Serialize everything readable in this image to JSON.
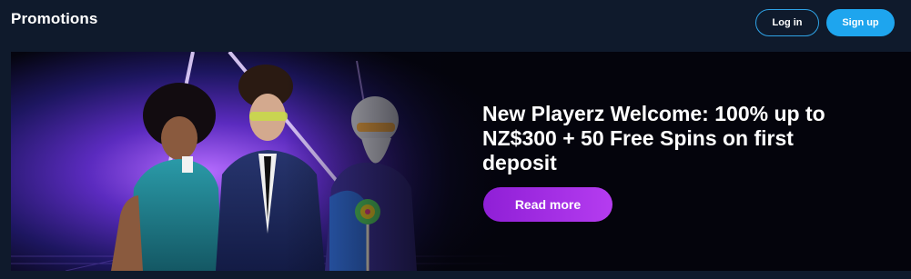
{
  "header": {
    "title": "Promotions",
    "login_label": "Log in",
    "signup_label": "Sign up"
  },
  "promo": {
    "headline": "New Playerz Welcome: 100% up to NZ$300 + 50 Free Spins on first deposit",
    "cta_label": "Read more"
  },
  "colors": {
    "background": "#0f1a2c",
    "login_border": "#2fa3e6",
    "signup_bg": "#1ea5ee",
    "cta_bg": "#a02ee3"
  }
}
